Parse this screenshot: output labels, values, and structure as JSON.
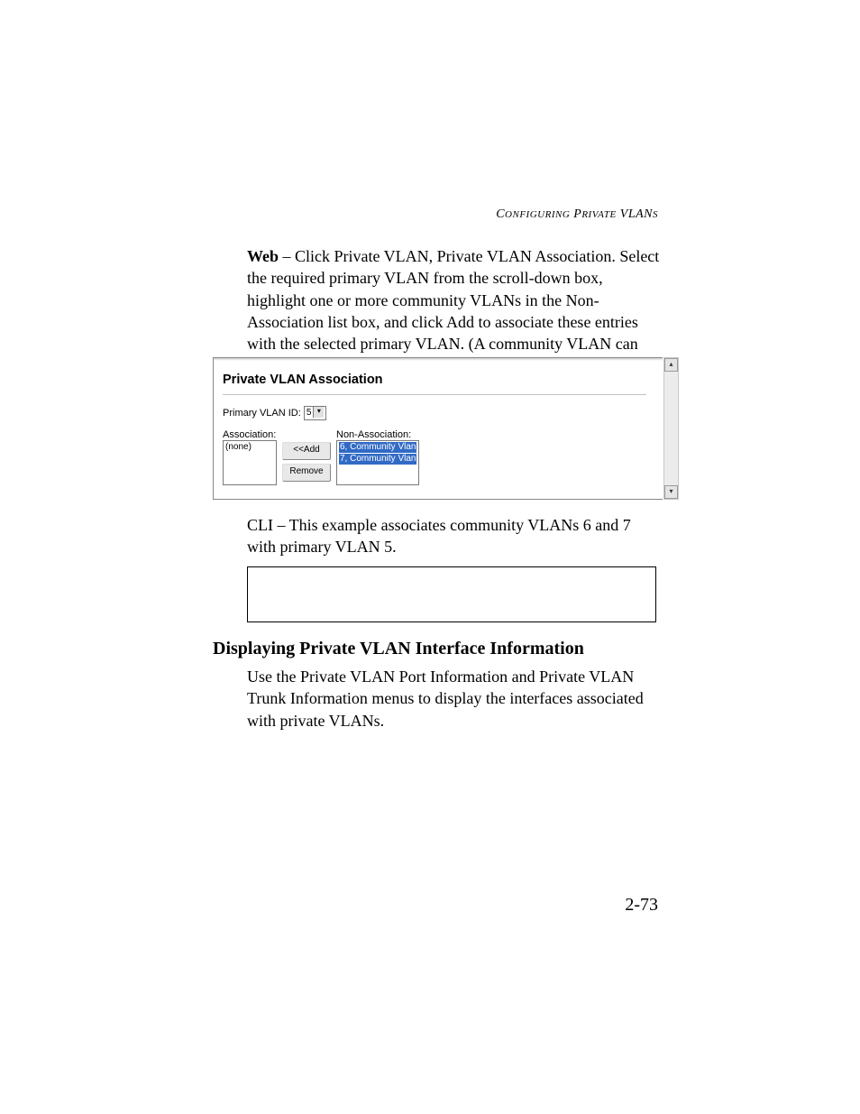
{
  "header": {
    "running_head": "Configuring Private VLANs"
  },
  "web_paragraph": {
    "lead": "Web",
    "text": " – Click Private VLAN, Private VLAN Association. Select the required primary VLAN from the scroll-down box, highlight one or more community VLANs in the Non-Association list box, and click Add to associate these entries with the selected primary VLAN. (A community VLAN can only be associated with one primary VLAN.)"
  },
  "screenshot": {
    "title": "Private VLAN Association",
    "primary_label": "Primary VLAN ID:",
    "primary_value": "5",
    "assoc_label": "Association:",
    "assoc_items": [
      "(none)"
    ],
    "nonassoc_label": "Non-Association:",
    "nonassoc_items": [
      "6, Community Vlan",
      "7, Community Vlan"
    ],
    "btn_add": "<<Add",
    "btn_remove": "Remove"
  },
  "cli_paragraph": {
    "lead": "CLI",
    "text": " – This example associates community VLANs 6 and 7 with primary VLAN 5."
  },
  "section": {
    "heading": "Displaying Private VLAN Interface Information",
    "body": "Use the Private VLAN Port Information and Private VLAN Trunk Information menus to display the interfaces associated with private VLANs."
  },
  "page_number": "2-73"
}
